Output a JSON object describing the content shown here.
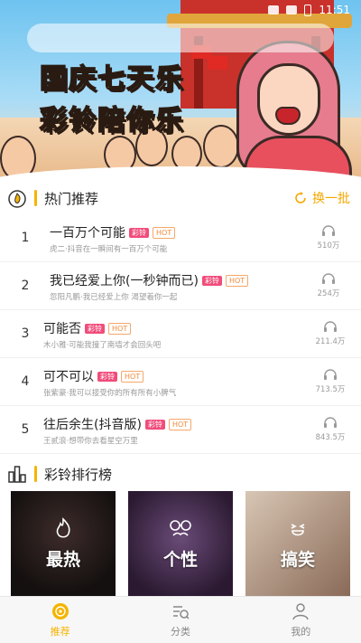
{
  "status_bar": {
    "time": "11:51"
  },
  "banner": {
    "title_line1": "国庆七天乐",
    "title_line2": "彩铃陪你乐"
  },
  "hot_section": {
    "title": "热门推荐",
    "refresh_label": "换一批",
    "badge_cl": "彩铃",
    "badge_hot": "HOT",
    "songs": [
      {
        "rank": "1",
        "name": "一百万个可能",
        "desc": "虎二·抖音在一瞬间有一百万个可能",
        "plays": "510万"
      },
      {
        "rank": "2",
        "name": "我已经爱上你(一秒钟而已)",
        "desc": "忽阳凡鹏·我已经爱上你 渴望着你一起",
        "plays": "254万"
      },
      {
        "rank": "3",
        "name": "可能否",
        "desc": "木小雅·可能我撞了南墙才会回头吧",
        "plays": "211.4万"
      },
      {
        "rank": "4",
        "name": "可不可以",
        "desc": "张紫豪·我可以接受你的所有所有小脾气",
        "plays": "713.5万"
      },
      {
        "rank": "5",
        "name": "往后余生(抖音版)",
        "desc": "王贰浪·想带你去看星空万里",
        "plays": "843.5万"
      }
    ]
  },
  "ranking_section": {
    "title": "彩铃排行榜",
    "tiles": [
      {
        "label": "最热"
      },
      {
        "label": "个性"
      },
      {
        "label": "搞笑"
      }
    ]
  },
  "bottom_nav": {
    "items": [
      {
        "label": "推荐",
        "active": true
      },
      {
        "label": "分类",
        "active": false
      },
      {
        "label": "我的",
        "active": false
      }
    ]
  },
  "colors": {
    "accent": "#f5b400",
    "badge_pink": "#f14c7a",
    "hot_orange": "#f08a3a"
  }
}
